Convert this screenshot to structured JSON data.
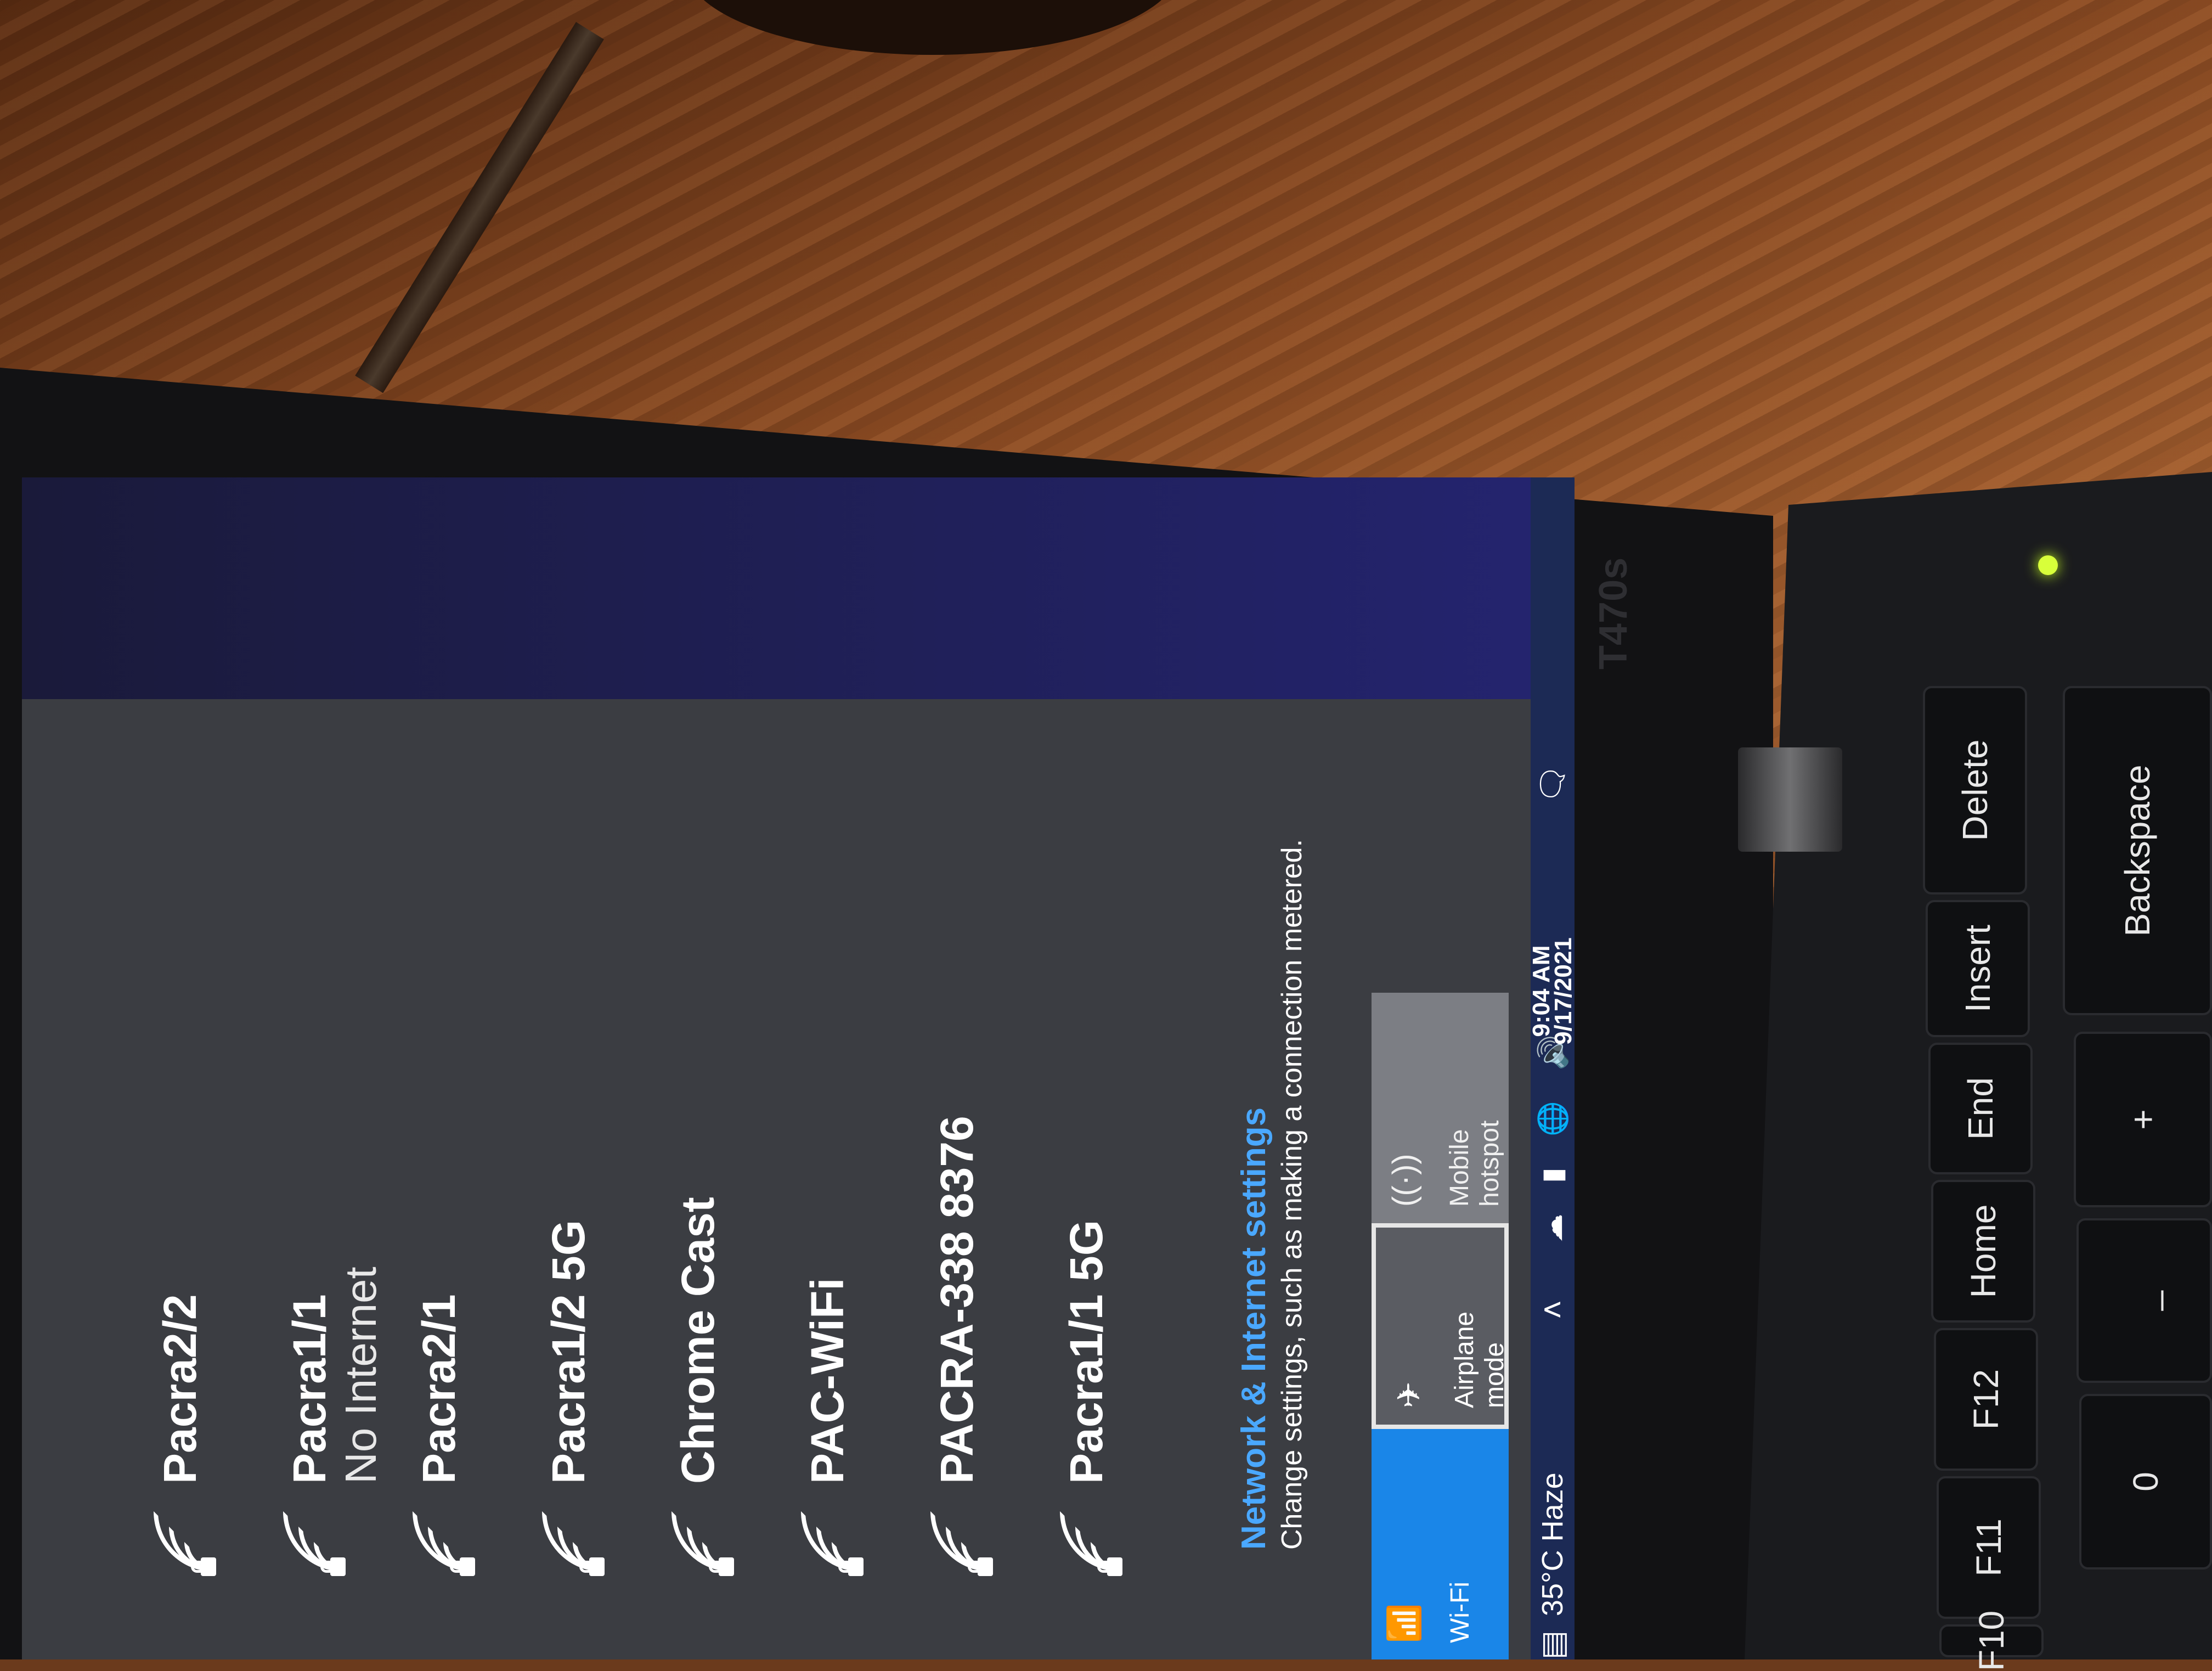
{
  "networks": [
    {
      "name": "Pacra2/2",
      "status": "",
      "icon": "wifi-lock-icon"
    },
    {
      "name": "Pacra1/1",
      "status": "No Internet",
      "icon": "wifi-lock-icon"
    },
    {
      "name": "Pacra2/1",
      "status": "",
      "icon": "wifi-lock-icon"
    },
    {
      "name": "Pacra1/2 5G",
      "status": "",
      "icon": "wifi-lock-icon"
    },
    {
      "name": "Chrome Cast",
      "status": "",
      "icon": "wifi-lock-icon"
    },
    {
      "name": "PAC-WiFi",
      "status": "",
      "icon": "wifi-lock-icon"
    },
    {
      "name": "PACRA-338 8376",
      "status": "",
      "icon": "wifi-lock-icon"
    },
    {
      "name": "Pacra1/1 5G",
      "status": "",
      "icon": "wifi-lock-icon"
    }
  ],
  "settings": {
    "link": "Network & Internet settings",
    "description": "Change settings, such as making a connection metered."
  },
  "quick_actions": {
    "wifi": "Wi-Fi",
    "airplane": "Airplane mode",
    "hotspot_line1": "Mobile",
    "hotspot_line2": "hotspot"
  },
  "taskbar": {
    "weather": "35°C  Haze",
    "time": "9:04 AM",
    "date": "9/17/2021"
  },
  "laptop": {
    "model": "T470s"
  },
  "keyboard": {
    "delete": "Delete",
    "insert": "Insert",
    "end": "End",
    "home": "Home",
    "backspace": "Backspace",
    "f12": "F12",
    "f11": "F11",
    "f10": "F10",
    "plus": "+",
    "equals": "=",
    "underscore": "_",
    "minus": "-",
    "paren": ")",
    "zero": "0"
  },
  "colors": {
    "accent": "#1a86e8",
    "link": "#4aa8ff",
    "flyout_bg": "#3b3d42",
    "taskbar_bg": "#1c2a55"
  }
}
